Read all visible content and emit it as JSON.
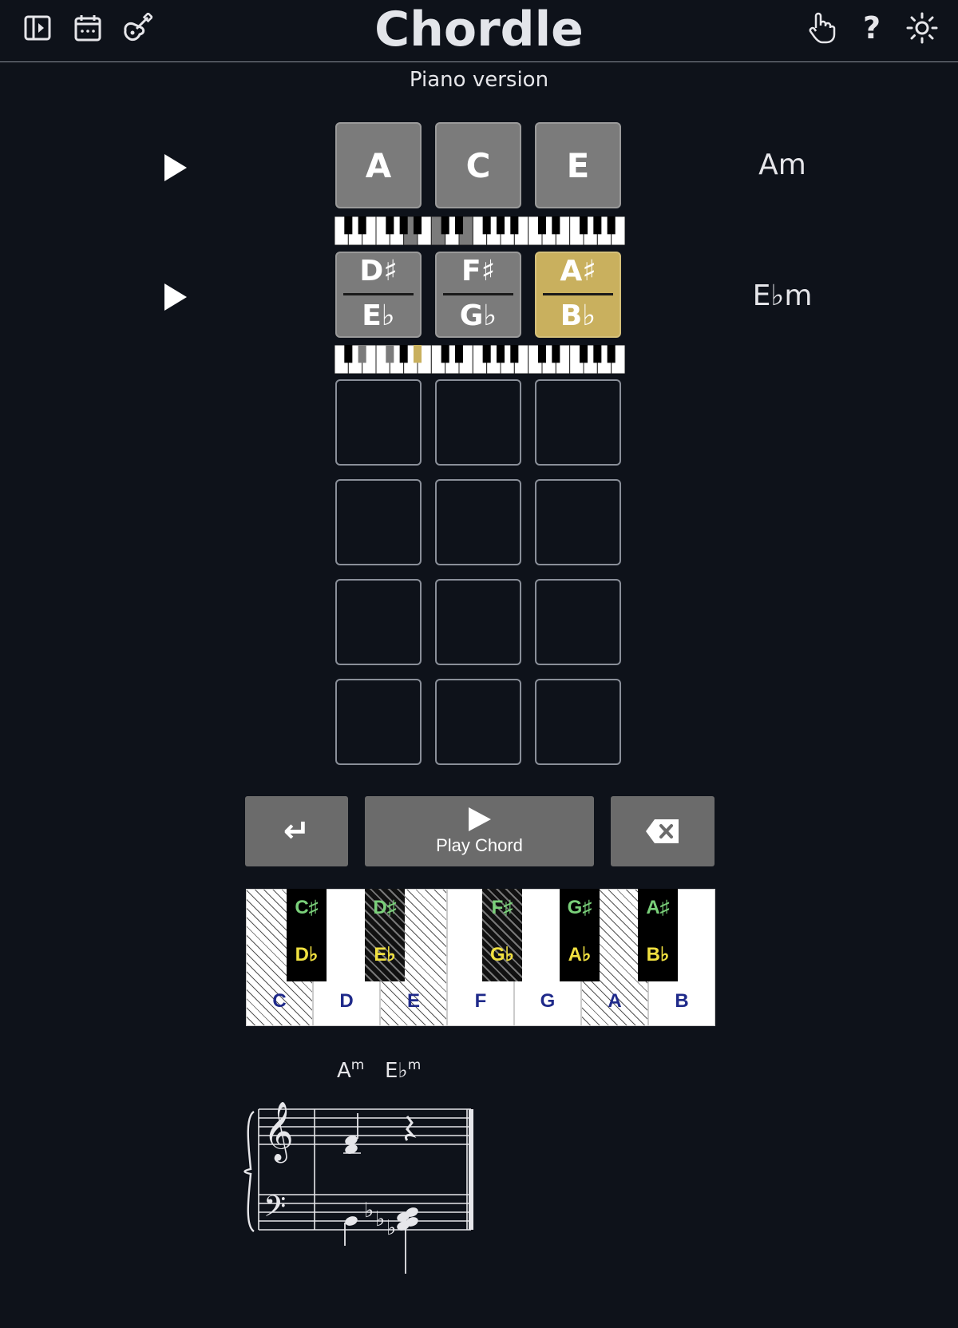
{
  "header": {
    "title": "Chordle",
    "subtitle": "Piano version",
    "icons_left": [
      "sidebar-toggle-icon",
      "calendar-icon",
      "guitar-icon"
    ],
    "icons_right": [
      "hand-pointer-icon",
      "help-icon",
      "sun-icon"
    ],
    "help_glyph": "?"
  },
  "board": {
    "rows": [
      {
        "tiles": [
          {
            "state": "filled",
            "sharp": "A",
            "flat": ""
          },
          {
            "state": "filled",
            "sharp": "C",
            "flat": ""
          },
          {
            "state": "filled",
            "sharp": "E",
            "flat": ""
          }
        ],
        "chord_name": "Am"
      },
      {
        "tiles": [
          {
            "state": "filled",
            "sharp": "D♯",
            "flat": "E♭"
          },
          {
            "state": "filled",
            "sharp": "F♯",
            "flat": "G♭"
          },
          {
            "state": "present",
            "sharp": "A♯",
            "flat": "B♭"
          }
        ],
        "chord_name": "E♭m"
      }
    ],
    "empty_rows": 4,
    "colors": {
      "filled": "#7b7b7b",
      "present": "#c9b05e",
      "empty_border": "#8a8f99"
    }
  },
  "controls": {
    "enter_glyph": "↵",
    "play_label": "Play Chord",
    "backspace_icon": "backspace-icon"
  },
  "keyboard": {
    "white_keys": [
      {
        "label": "C",
        "hatched": true
      },
      {
        "label": "D",
        "hatched": false
      },
      {
        "label": "E",
        "hatched": true
      },
      {
        "label": "F",
        "hatched": false
      },
      {
        "label": "G",
        "hatched": false
      },
      {
        "label": "A",
        "hatched": true
      },
      {
        "label": "B",
        "hatched": false
      }
    ],
    "black_keys": [
      {
        "sharp": "C♯",
        "flat": "D♭",
        "hatched": false
      },
      {
        "sharp": "D♯",
        "flat": "E♭",
        "hatched": true
      },
      {
        "sharp": "F♯",
        "flat": "G♭",
        "hatched": true
      },
      {
        "sharp": "G♯",
        "flat": "A♭",
        "hatched": false
      },
      {
        "sharp": "A♯",
        "flat": "B♭",
        "hatched": false
      }
    ]
  },
  "score": {
    "chords": [
      {
        "root": "A",
        "quality": "m"
      },
      {
        "root": "E♭",
        "quality": "m"
      }
    ]
  }
}
